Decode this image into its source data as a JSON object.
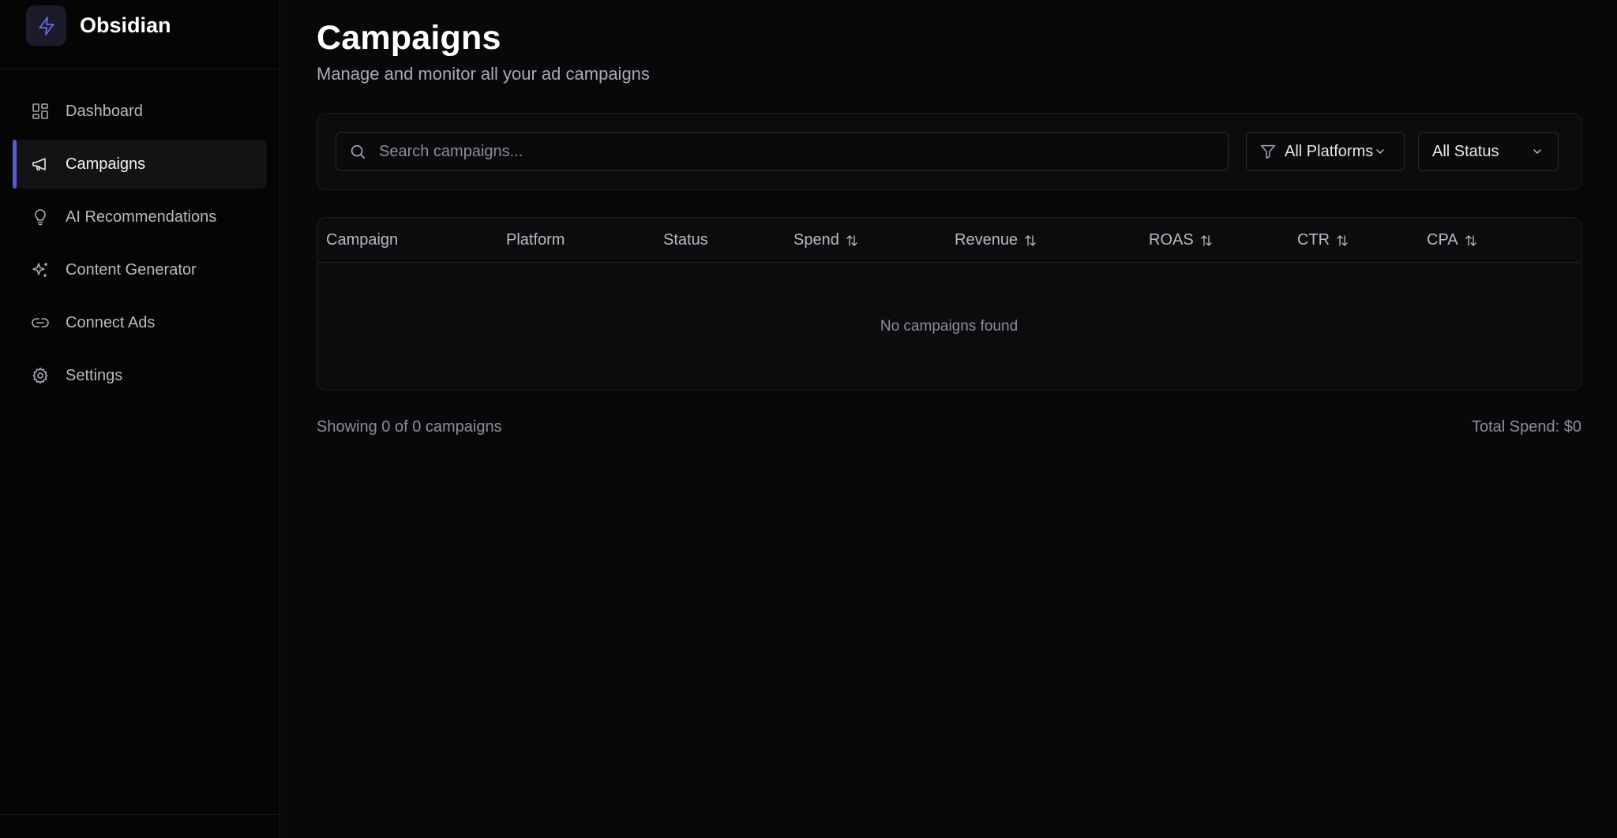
{
  "brand": {
    "name": "Obsidian",
    "icon": "bolt-icon",
    "accent": "#5b5bd6"
  },
  "sidebar": {
    "items": [
      {
        "label": "Dashboard",
        "icon": "grid-icon",
        "active": false
      },
      {
        "label": "Campaigns",
        "icon": "megaphone-icon",
        "active": true
      },
      {
        "label": "AI Recommendations",
        "icon": "lightbulb-icon",
        "active": false
      },
      {
        "label": "Content Generator",
        "icon": "sparkles-icon",
        "active": false
      },
      {
        "label": "Connect Ads",
        "icon": "link-icon",
        "active": false
      },
      {
        "label": "Settings",
        "icon": "gear-icon",
        "active": false
      }
    ]
  },
  "page": {
    "title": "Campaigns",
    "subtitle": "Manage and monitor all your ad campaigns"
  },
  "filters": {
    "search_placeholder": "Search campaigns...",
    "search_value": "",
    "platform_selected": "All Platforms",
    "status_selected": "All Status"
  },
  "table": {
    "columns": [
      {
        "label": "Campaign",
        "sortable": false
      },
      {
        "label": "Platform",
        "sortable": false
      },
      {
        "label": "Status",
        "sortable": false
      },
      {
        "label": "Spend",
        "sortable": true
      },
      {
        "label": "Revenue",
        "sortable": true
      },
      {
        "label": "ROAS",
        "sortable": true
      },
      {
        "label": "CTR",
        "sortable": true
      },
      {
        "label": "CPA",
        "sortable": true
      }
    ],
    "rows": [],
    "empty_message": "No campaigns found"
  },
  "footer": {
    "showing_text": "Showing 0 of 0 campaigns",
    "total_spend_text": "Total Spend: $0"
  }
}
